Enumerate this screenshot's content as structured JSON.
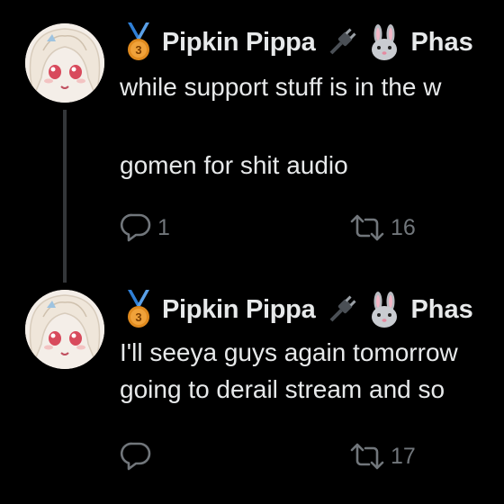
{
  "tweets": [
    {
      "medal": "3",
      "author_name": "Pipkin Pippa",
      "handle_fragment": "Phas",
      "text_lines": [
        "while support stuff is in the w",
        "",
        "gomen for shit audio"
      ],
      "reply_count": "1",
      "retweet_count": "16"
    },
    {
      "medal": "3",
      "author_name": "Pipkin Pippa",
      "handle_fragment": "Phas",
      "text_lines": [
        "I'll seeya guys again tomorrow",
        "going to derail stream and so"
      ],
      "reply_count": "",
      "retweet_count": "17"
    }
  ],
  "icons": {
    "medal": "medal-icon",
    "plug": "plug-icon",
    "bunny": "bunny-icon",
    "reply": "reply-icon",
    "retweet": "retweet-icon"
  },
  "colors": {
    "background": "#000000",
    "text": "#e7e9ea",
    "muted": "#71767b",
    "thread_line": "#333639",
    "medal_gold": "#e08a1e"
  }
}
